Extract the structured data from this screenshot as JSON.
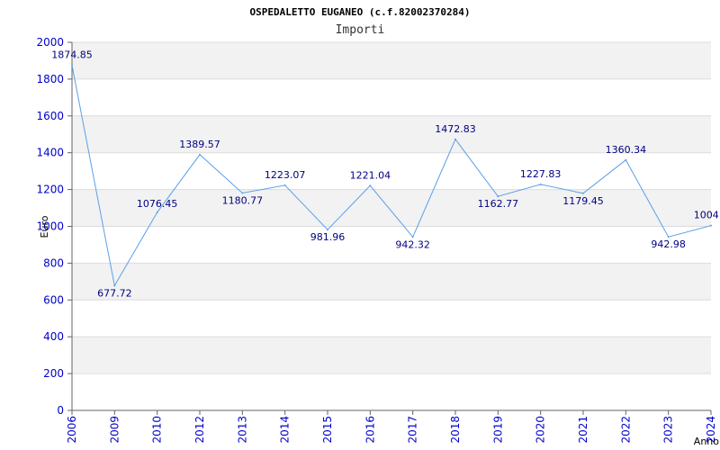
{
  "chart_data": {
    "type": "line",
    "title": "OSPEDALETTO EUGANEO (c.f.82002370284)",
    "subtitle": "Importi",
    "xlabel": "Anno",
    "ylabel": "Euro",
    "ylim": [
      0,
      2000
    ],
    "yticks": [
      0,
      200,
      400,
      600,
      800,
      1000,
      1200,
      1400,
      1600,
      1800,
      2000
    ],
    "grid": true,
    "categories": [
      "2006",
      "2009",
      "2010",
      "2012",
      "2013",
      "2014",
      "2015",
      "2016",
      "2017",
      "2018",
      "2019",
      "2020",
      "2021",
      "2022",
      "2023",
      "2024"
    ],
    "values": [
      1874.85,
      677.72,
      1076.45,
      1389.57,
      1180.77,
      1223.07,
      981.96,
      1221.04,
      942.32,
      1472.83,
      1162.77,
      1227.83,
      1179.45,
      1360.34,
      942.98,
      1004.0
    ],
    "value_labels": [
      "1874.85",
      "677.72",
      "1076.45",
      "1389.57",
      "1180.77",
      "1223.07",
      "981.96",
      "1221.04",
      "942.32",
      "1472.83",
      "1162.77",
      "1227.83",
      "1179.45",
      "1360.34",
      "942.98",
      "1004.0"
    ],
    "colors": {
      "line": "#5aa0e8",
      "band": "#f2f2f2",
      "grid": "#dcdcdc",
      "tick_text": "#0000cc",
      "data_label": "#000080"
    }
  }
}
